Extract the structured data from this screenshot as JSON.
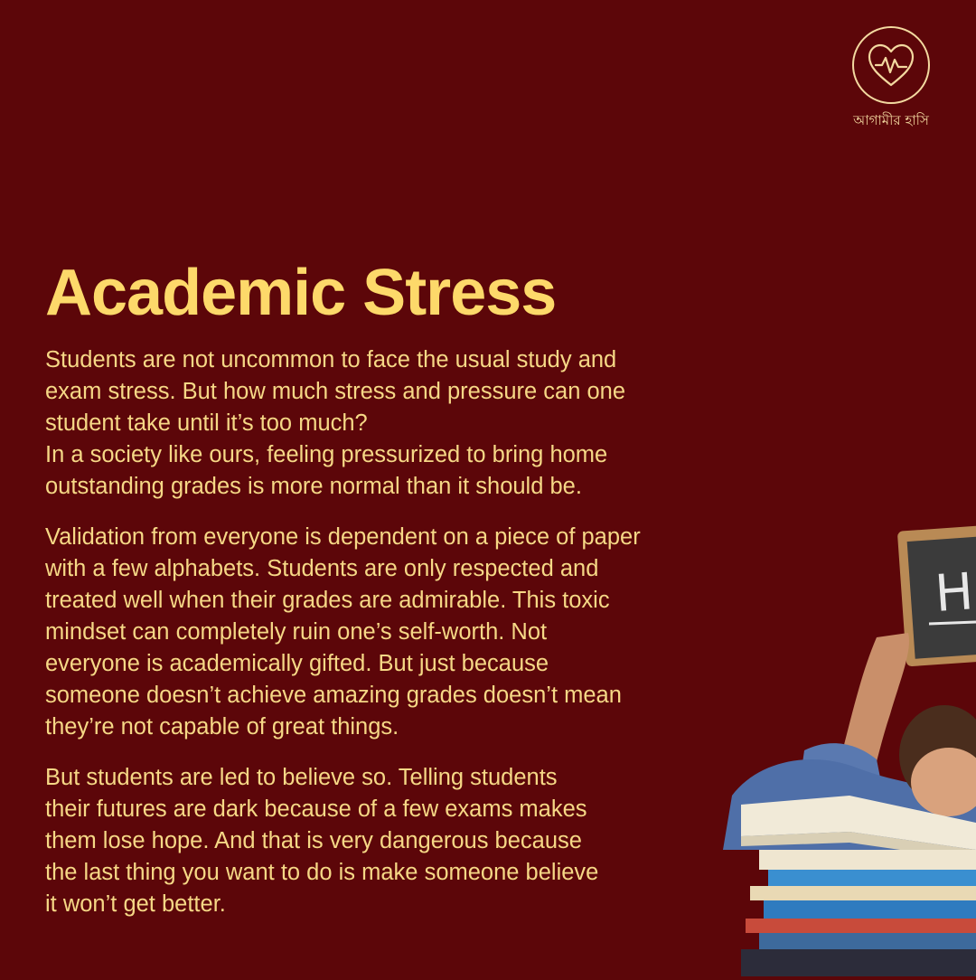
{
  "brand": {
    "logo_icon": "heart-heartbeat-icon",
    "name": "আগামীর হাসি",
    "color": "#f3d9a0"
  },
  "title": "Academic Stress",
  "paragraphs": [
    "Students are not uncommon to face the usual study and\nexam stress. But how much stress and pressure can one\nstudent take until it’s too much?\nIn a society like ours, feeling pressurized to bring home\noutstanding grades is more normal than it should be.",
    "Validation from everyone is dependent on a piece of paper\nwith a few alphabets. Students are only respected and\ntreated well when their grades are admirable. This toxic\nmindset can completely ruin one’s self-worth. Not\neveryone is academically gifted. But just because\nsomeone doesn’t achieve amazing grades doesn’t mean\nthey’re not capable of great things.",
    "But students are led to believe so. Telling students\ntheir futures are dark because of a few exams makes\nthem lose hope. And that is very dangerous because\nthe last thing you want to do is make someone believe\nit won’t get better."
  ],
  "photo": {
    "description_icon": "student-with-books-icon",
    "chalkboard_text": "H"
  },
  "colors": {
    "background": "#5c0609",
    "title": "#fdd96a",
    "body": "#f6d886"
  }
}
